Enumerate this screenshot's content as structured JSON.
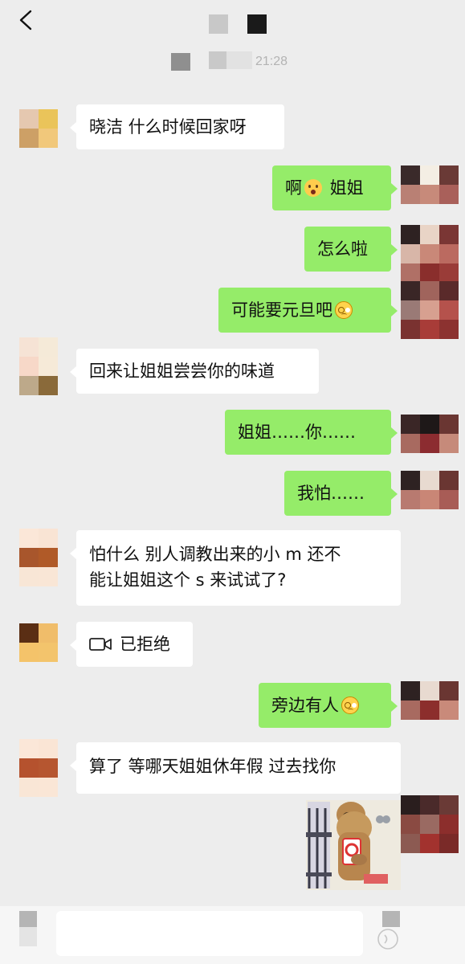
{
  "header": {
    "back_icon": "chevron-left-icon",
    "timestamp": "21:28"
  },
  "messages": [
    {
      "side": "in",
      "text": "晓洁 什么时候回家呀"
    },
    {
      "side": "out",
      "text_before": "啊",
      "emoji": "surprised-face-emoji",
      "text_after": " 姐姐"
    },
    {
      "side": "out",
      "text": "怎么啦"
    },
    {
      "side": "out",
      "text_before": "可能要元旦吧",
      "emoji": "pleading-face-emoji"
    },
    {
      "side": "in",
      "text": "回来让姐姐尝尝你的味道"
    },
    {
      "side": "out",
      "text": "姐姐……你……"
    },
    {
      "side": "out",
      "text": "我怕……"
    },
    {
      "side": "in",
      "lines": [
        "怕什么 别人调教出来的小 m 还不",
        "能让姐姐这个 s 来试试了?"
      ]
    },
    {
      "side": "in",
      "call_icon": "video-camera-icon",
      "text": "已拒绝"
    },
    {
      "side": "out",
      "text_before": "旁边有人",
      "emoji": "pleading-face-emoji"
    },
    {
      "side": "in",
      "text": "算了 等哪天姐姐休年假 过去找你"
    },
    {
      "side": "out",
      "sticker": "dog-holding-phone-sticker"
    }
  ],
  "input_bar": {
    "left_icon": "voice-toggle-icon",
    "right_icon": "voice-icon",
    "input_value": ""
  },
  "colors": {
    "background": "#ededed",
    "incoming_bubble": "#ffffff",
    "outgoing_bubble": "#95ec69"
  }
}
